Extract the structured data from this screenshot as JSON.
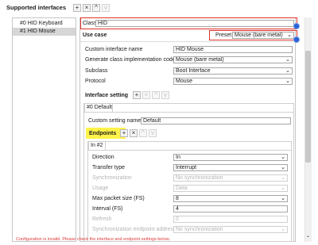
{
  "supported_interfaces": {
    "title": "Supported interfaces",
    "toolbar": {
      "add": "+",
      "remove": "×",
      "up": "^",
      "down": "v"
    },
    "items": [
      "#0 HID Keyboard",
      "#1 HID Mouse"
    ]
  },
  "class_row": {
    "label": "Class",
    "value": "HID"
  },
  "use_case": {
    "title": "Use case",
    "preset_label": "Preset",
    "preset_value": "Mouse (bare metal)"
  },
  "fields": [
    {
      "label": "Custom interface name",
      "value": "HID Mouse",
      "type": "text"
    },
    {
      "label": "Generate class implementation code",
      "value": "Mouse (bare metal)",
      "type": "select"
    },
    {
      "label": "Subclass",
      "value": "Boot Interface",
      "type": "select"
    },
    {
      "label": "Protocol",
      "value": "Mouse",
      "type": "select"
    }
  ],
  "interface_setting": {
    "title": "Interface setting",
    "tab": "#0 Default",
    "custom_name_label": "Custom setting name",
    "custom_name_value": "Default"
  },
  "endpoints": {
    "title": "Endpoints",
    "tab": "In #2",
    "fields": [
      {
        "label": "Direction",
        "value": "In",
        "type": "select",
        "disabled": false
      },
      {
        "label": "Transfer type",
        "value": "Interrupt",
        "type": "select",
        "disabled": false
      },
      {
        "label": "Synchronization",
        "value": "No synchronization",
        "type": "select",
        "disabled": true
      },
      {
        "label": "Usage",
        "value": "Data",
        "type": "select",
        "disabled": true
      },
      {
        "label": "Max packet size (FS)",
        "value": "8",
        "type": "select",
        "disabled": false
      },
      {
        "label": "Interval (FS)",
        "value": "4",
        "type": "text",
        "disabled": false
      },
      {
        "label": "Refresh",
        "value": "0",
        "type": "text",
        "disabled": true
      },
      {
        "label": "Synchronization endpoint address",
        "value": "No synchronization",
        "type": "select",
        "disabled": true
      }
    ]
  },
  "warning_text": "Configuration is invalid. Please check the interface and endpoint settings below."
}
